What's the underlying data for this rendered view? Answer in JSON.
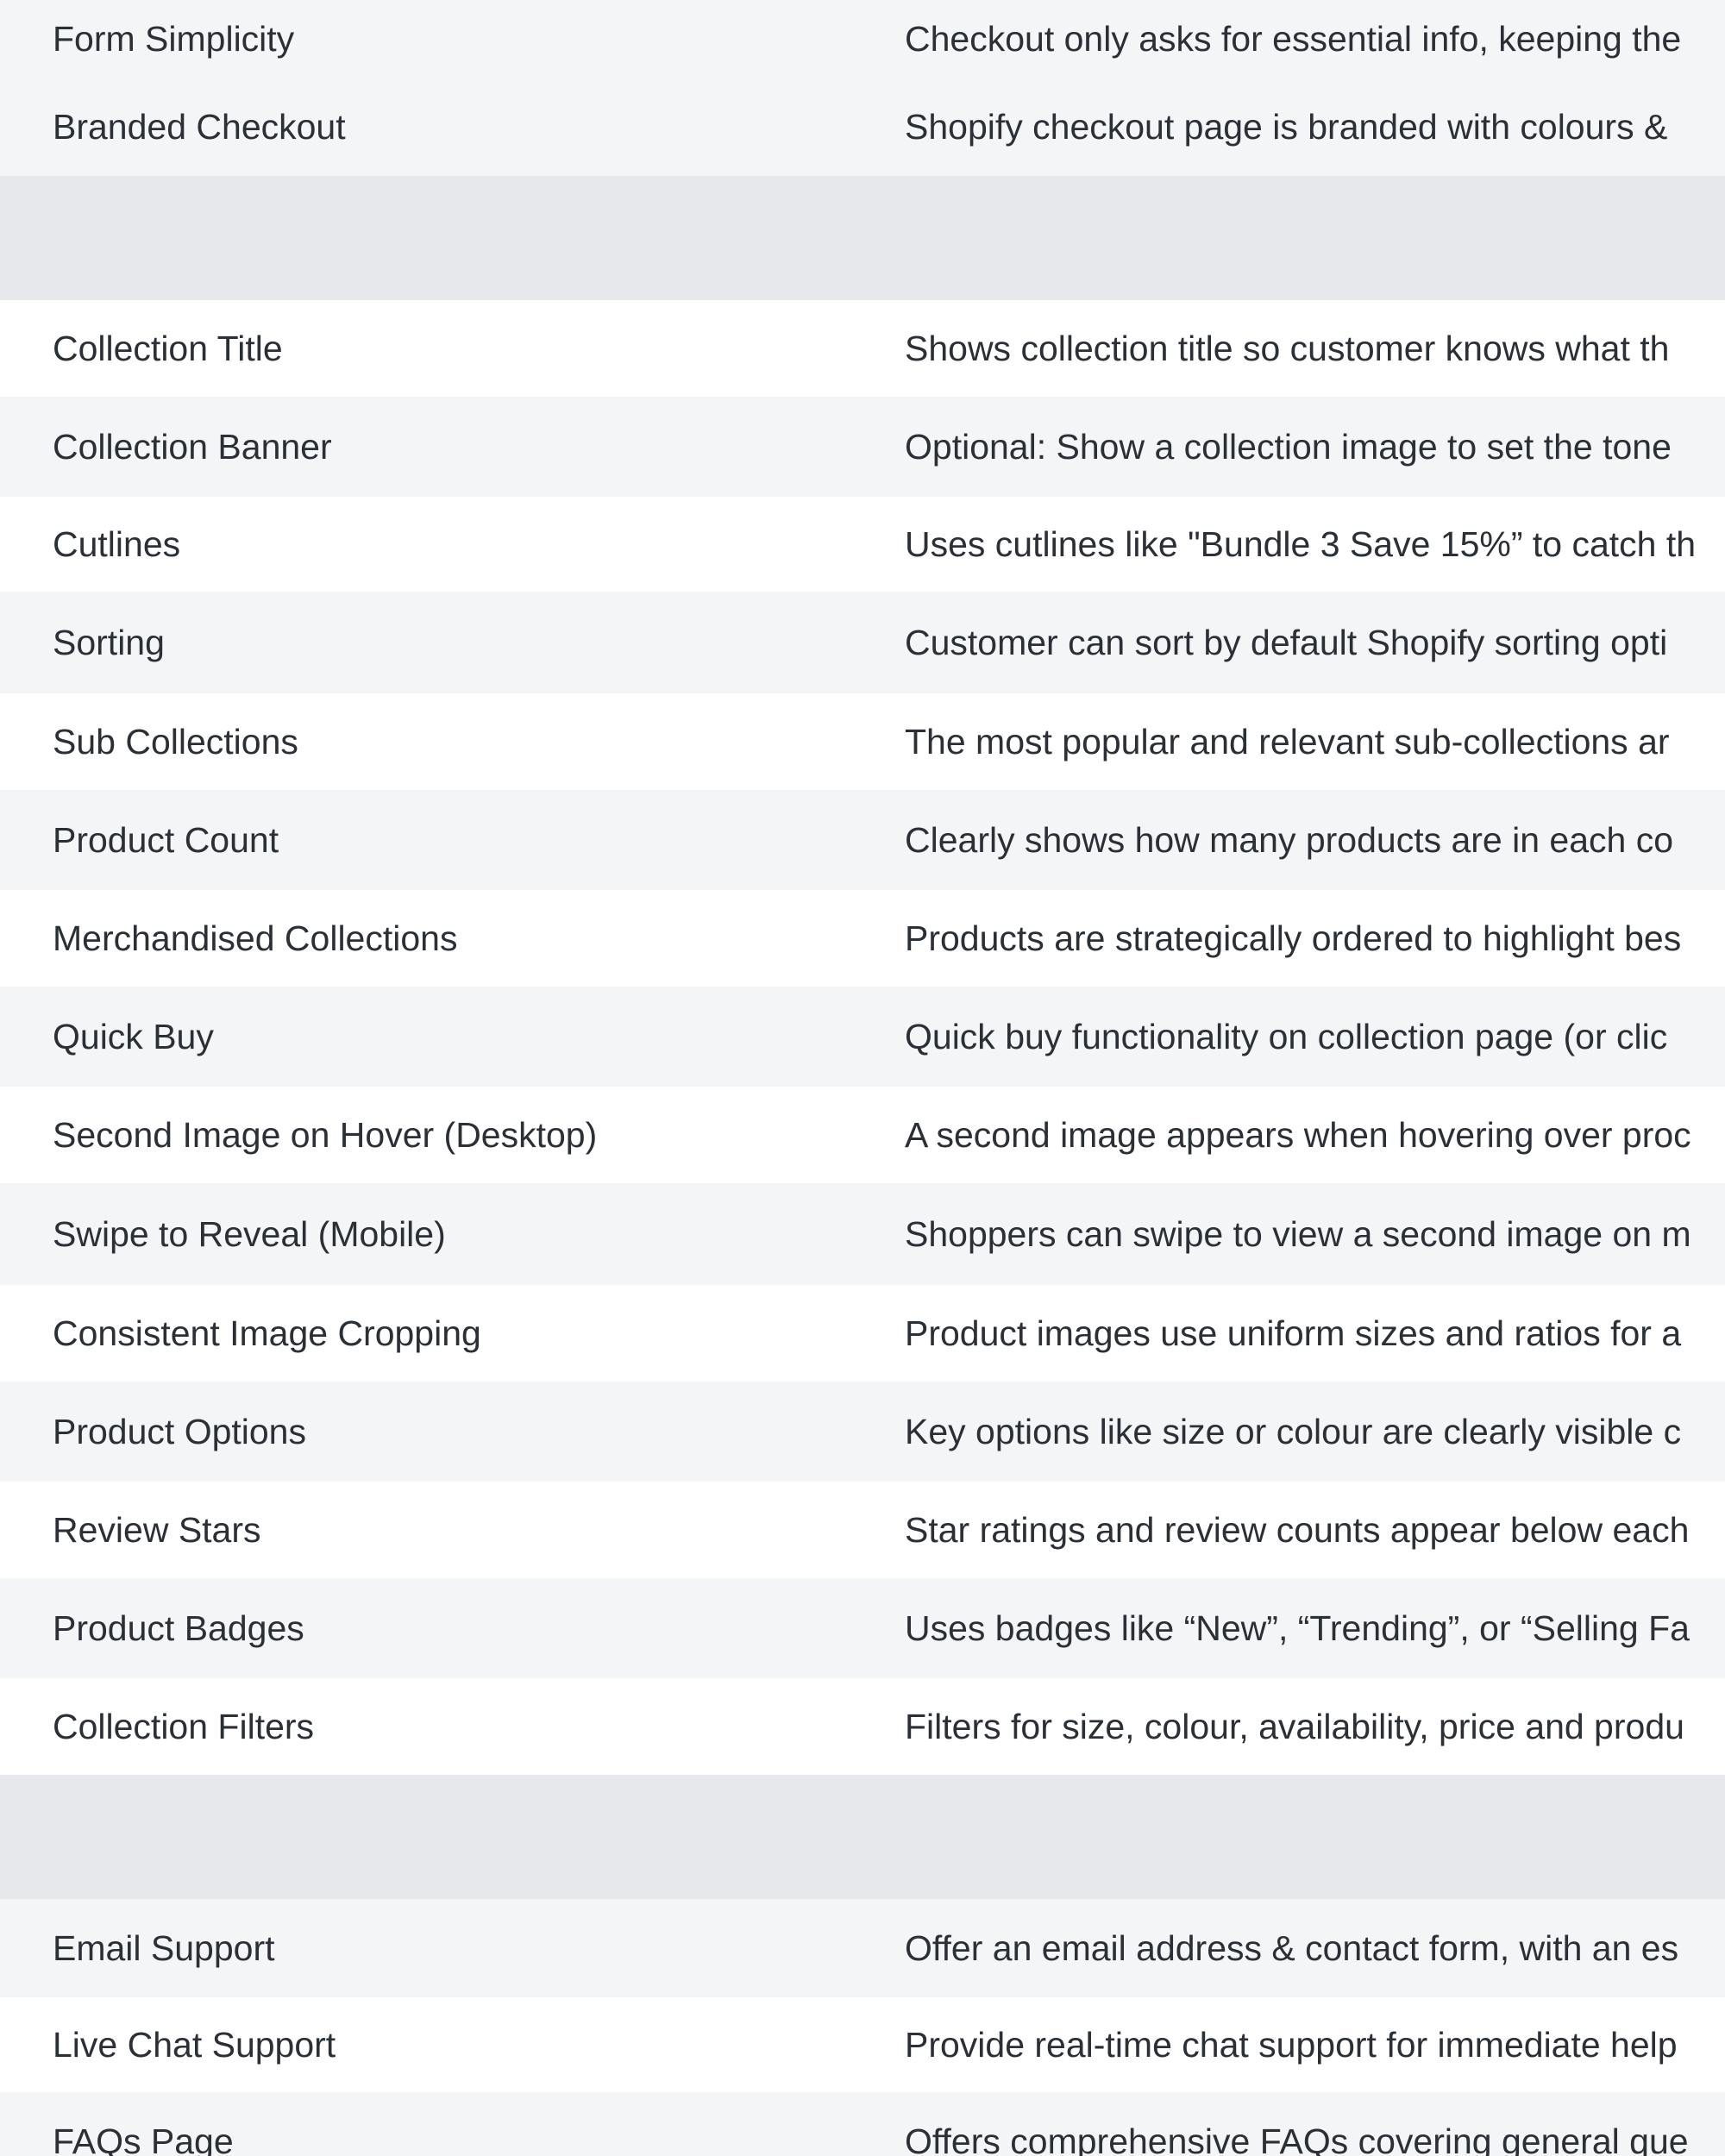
{
  "table": {
    "rows": [
      {
        "type": "item",
        "feature": "Form Simplicity",
        "description": "Checkout only asks for essential info, keeping the"
      },
      {
        "type": "item",
        "feature": "Branded Checkout",
        "description": "Shopify checkout page is branded with colours &"
      },
      {
        "type": "section",
        "feature": "",
        "description": ""
      },
      {
        "type": "item",
        "feature": "Collection Title",
        "description": "Shows collection title so customer knows what th"
      },
      {
        "type": "item",
        "feature": "Collection Banner",
        "description": "Optional: Show a collection image to set the tone"
      },
      {
        "type": "item",
        "feature": "Cutlines",
        "description": "Uses cutlines like \"Bundle 3 Save 15%” to catch th"
      },
      {
        "type": "item",
        "feature": "Sorting",
        "description": "Customer can sort by default Shopify sorting opti"
      },
      {
        "type": "item",
        "feature": "Sub Collections",
        "description": "The most popular and relevant sub-collections ar"
      },
      {
        "type": "item",
        "feature": "Product Count",
        "description": "Clearly shows how many products are in each co"
      },
      {
        "type": "item",
        "feature": "Merchandised Collections",
        "description": "Products are strategically ordered to highlight bes"
      },
      {
        "type": "item",
        "feature": "Quick Buy",
        "description": "Quick buy functionality on collection page (or clic"
      },
      {
        "type": "item",
        "feature": "Second Image on Hover (Desktop)",
        "description": "A second image appears when hovering over proc"
      },
      {
        "type": "item",
        "feature": "Swipe to Reveal (Mobile)",
        "description": "Shoppers can swipe to view a second image on m"
      },
      {
        "type": "item",
        "feature": "Consistent Image Cropping",
        "description": "Product images use uniform sizes and ratios for a"
      },
      {
        "type": "item",
        "feature": "Product Options",
        "description": "Key options like size or colour are clearly visible c"
      },
      {
        "type": "item",
        "feature": "Review Stars",
        "description": "Star ratings and review counts appear below each"
      },
      {
        "type": "item",
        "feature": "Product Badges",
        "description": "Uses badges like “New”, “Trending”, or “Selling Fa"
      },
      {
        "type": "item",
        "feature": "Collection Filters",
        "description": "Filters for size, colour, availability, price and produ"
      },
      {
        "type": "section",
        "feature": "",
        "description": ""
      },
      {
        "type": "item",
        "feature": "Email Support",
        "description": "Offer an email address & contact form, with an es"
      },
      {
        "type": "item",
        "feature": "Live Chat Support",
        "description": "Provide real-time chat support for immediate help"
      },
      {
        "type": "item",
        "feature": "FAQs Page",
        "description": "Offers comprehensive FAQs covering general que"
      }
    ]
  }
}
